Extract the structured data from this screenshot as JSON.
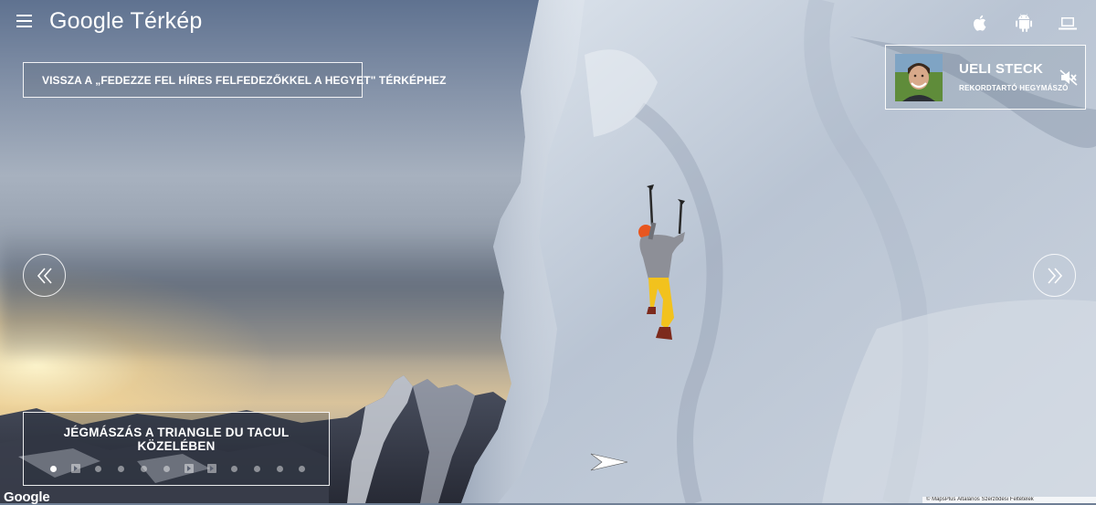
{
  "app": {
    "logo": "Google Térkép"
  },
  "header": {
    "icons": [
      "apple-icon",
      "android-icon",
      "laptop-icon"
    ]
  },
  "back_link": {
    "label": "VISSZA A „FEDEZZE FEL HÍRES FELFEDEZŐKKEL A HEGYET\" TÉRKÉPHEZ"
  },
  "profile": {
    "name": "UELI STECK",
    "role": "REKORDTARTÓ HEGYMÁSZÓ"
  },
  "caption": {
    "title": "JÉGMÁSZÁS A TRIANGLE DU TACUL KÖZELÉBEN",
    "dots": [
      {
        "type": "dot",
        "active": true
      },
      {
        "type": "video",
        "active": false
      },
      {
        "type": "dot",
        "active": false
      },
      {
        "type": "dot",
        "active": false
      },
      {
        "type": "dot",
        "active": false
      },
      {
        "type": "dot",
        "active": false
      },
      {
        "type": "video",
        "active": false
      },
      {
        "type": "video",
        "active": false
      },
      {
        "type": "dot",
        "active": false
      },
      {
        "type": "dot",
        "active": false
      },
      {
        "type": "dot",
        "active": false
      },
      {
        "type": "dot",
        "active": false
      }
    ]
  },
  "footer": {
    "logo": "Google",
    "attribution": "© MapsPlus   Általános Szerződési Feltételek"
  },
  "colors": {
    "text": "#ffffff",
    "border": "#ffffff"
  }
}
